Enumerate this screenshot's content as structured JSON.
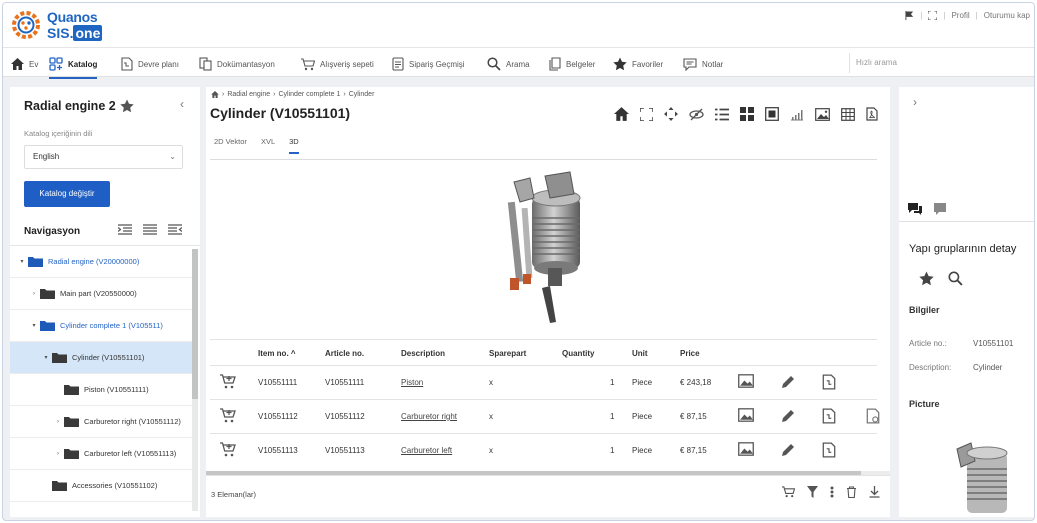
{
  "brand": {
    "line1": "Quanos",
    "line2_prefix": "SIS.",
    "line2_suffix": "one"
  },
  "top_right": {
    "profile": "Profil",
    "logout": "Oturumu kap"
  },
  "nav": {
    "items": [
      {
        "label": "Ev",
        "icon": "home-icon"
      },
      {
        "label": "Katalog",
        "icon": "catalog-icon",
        "active": true
      },
      {
        "label": "Devre planı",
        "icon": "circuit-icon"
      },
      {
        "label": "Dokümantasyon",
        "icon": "documentation-icon"
      },
      {
        "label": "Alışveriş sepeti",
        "icon": "cart-icon"
      },
      {
        "label": "Sipariş Geçmişi",
        "icon": "order-history-icon"
      },
      {
        "label": "Arama",
        "icon": "search-icon"
      },
      {
        "label": "Belgeler",
        "icon": "documents-icon"
      },
      {
        "label": "Favoriler",
        "icon": "star-icon"
      },
      {
        "label": "Notlar",
        "icon": "notes-icon"
      }
    ],
    "quick_search_placeholder": "Hızlı arama"
  },
  "left": {
    "title": "Radial engine 2",
    "catalog_lang_label": "Katalog içeriğinin dili",
    "language_value": "English",
    "change_catalog_button": "Katalog değiştir",
    "navigation_label": "Navigasyon",
    "tree": [
      {
        "label": "Radial engine (V20000000)",
        "toggle": "▾",
        "level": 0,
        "blue": true
      },
      {
        "label": "Main part (V20550000)",
        "toggle": "›",
        "level": 1
      },
      {
        "label": "Cylinder complete 1 (V105511)",
        "toggle": "▾",
        "level": 1,
        "blue": true
      },
      {
        "label": "Cylinder (V10551101)",
        "toggle": "▾",
        "level": 2,
        "selected": true
      },
      {
        "label": "Piston (V10551111)",
        "toggle": "",
        "level": 3
      },
      {
        "label": "Carburetor right (V10551112)",
        "toggle": "›",
        "level": 3
      },
      {
        "label": "Carburetor left (V10551113)",
        "toggle": "›",
        "level": 3
      },
      {
        "label": "Accessories (V10551102)",
        "toggle": "",
        "level": 2
      }
    ]
  },
  "center": {
    "breadcrumb": [
      "Radial engine",
      "Cylinder complete 1",
      "Cylinder"
    ],
    "title": "Cylinder (V10551101)",
    "subtabs": [
      "2D Vektor",
      "XVL",
      "3D"
    ],
    "active_subtab": "3D",
    "columns": {
      "item_no": "Item no. ^",
      "article_no": "Article no.",
      "description": "Description",
      "sparepart": "Sparepart",
      "quantity": "Quantity",
      "unit": "Unit",
      "price": "Price"
    },
    "rows": [
      {
        "item_no": "V10551111",
        "article_no": "V10551111",
        "description": "Piston",
        "sparepart": "x",
        "quantity": "1",
        "unit": "Piece",
        "price": "€ 243,18"
      },
      {
        "item_no": "V10551112",
        "article_no": "V10551112",
        "description": "Carburetor right",
        "sparepart": "x",
        "quantity": "1",
        "unit": "Piece",
        "price": "€ 87,15"
      },
      {
        "item_no": "V10551113",
        "article_no": "V10551113",
        "description": "Carburetor left",
        "sparepart": "x",
        "quantity": "1",
        "unit": "Piece",
        "price": "€ 87,15"
      }
    ],
    "count_label": "3 Eleman(lar)"
  },
  "right": {
    "title": "Yapı gruplarının detay",
    "info_section": "Bilgiler",
    "article_no_label": "Article no.:",
    "article_no_value": "V10551101",
    "description_label": "Description:",
    "description_value": "Cylinder",
    "picture_section": "Picture"
  },
  "colors": {
    "accent": "#1f5ec4",
    "selected_row": "#d4e6f8",
    "folder": "#1e5ab8"
  }
}
